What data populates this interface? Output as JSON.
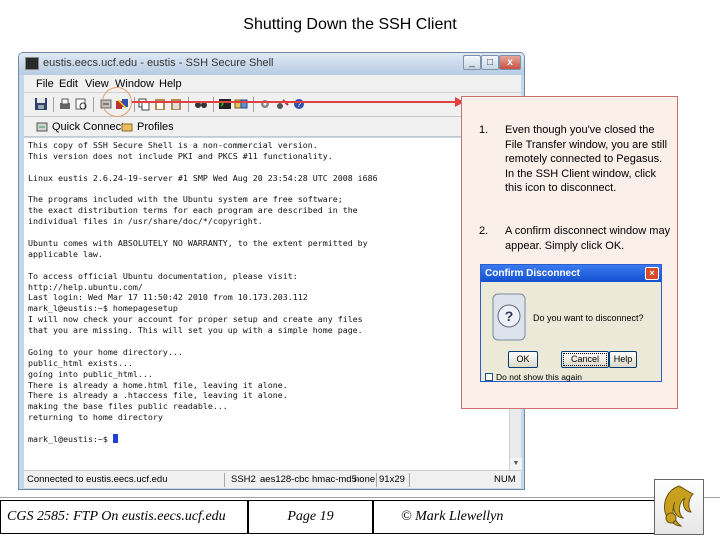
{
  "slide": {
    "title": "Shutting Down the SSH Client"
  },
  "ssh_window": {
    "title": "eustis.eecs.ucf.edu - eustis - SSH Secure Shell",
    "menu": [
      "File",
      "Edit",
      "View",
      "Window",
      "Help"
    ],
    "quickbar": {
      "quick_connect": "Quick Connect",
      "profiles": "Profiles"
    },
    "terminal_lines": [
      "This copy of SSH Secure Shell is a non-commercial version.",
      "This version does not include PKI and PKCS #11 functionality.",
      "",
      "Linux eustis 2.6.24-19-server #1 SMP Wed Aug 20 23:54:28 UTC 2008 i686",
      "",
      "The programs included with the Ubuntu system are free software;",
      "the exact distribution terms for each program are described in the",
      "individual files in /usr/share/doc/*/copyright.",
      "",
      "Ubuntu comes with ABSOLUTELY NO WARRANTY, to the extent permitted by",
      "applicable law.",
      "",
      "To access official Ubuntu documentation, please visit:",
      "http://help.ubuntu.com/",
      "Last login: Wed Mar 17 11:50:42 2010 from 10.173.203.112",
      "mark_l@eustis:~$ homepagesetup",
      "I will now check your account for proper setup and create any files",
      "that you are missing. This will set you up with a simple home page.",
      "",
      "Going to your home directory...",
      "public_html exists...",
      "going into public_html...",
      "There is already a home.html file, leaving it alone.",
      "There is already a .htaccess file, leaving it alone.",
      "making the base files public readable...",
      "returning to home directory",
      "",
      "mark_l@eustis:~$ "
    ],
    "status": {
      "connected": "Connected to eustis.eecs.ucf.edu",
      "protocol": "SSH2",
      "cipher": "aes128-cbc",
      "mac": "hmac-md5",
      "compression": "none",
      "size": "91x29",
      "num": "NUM"
    }
  },
  "instructions": [
    {
      "num": "1.",
      "text": "Even though you've closed the File Transfer window, you are still remotely connected to Pegasus.  In the SSH Client window, click this icon to disconnect."
    },
    {
      "num": "2.",
      "text": "A confirm disconnect window may appear.  Simply click OK."
    }
  ],
  "dialog": {
    "title": "Confirm Disconnect",
    "close": "×",
    "message": "Do you want to disconnect?",
    "ok": "OK",
    "cancel": "Cancel",
    "help": "Help",
    "checkbox": "Do not show this again"
  },
  "footer": {
    "course": "CGS 2585:  FTP On eustis.eecs.ucf.edu",
    "page": "Page 19",
    "author": "© Mark Llewellyn"
  },
  "colors": {
    "arrow": "#e04040",
    "callout_border": "#c97070",
    "callout_fill": "#fbefe9",
    "dialog_title": "#1250d0"
  }
}
